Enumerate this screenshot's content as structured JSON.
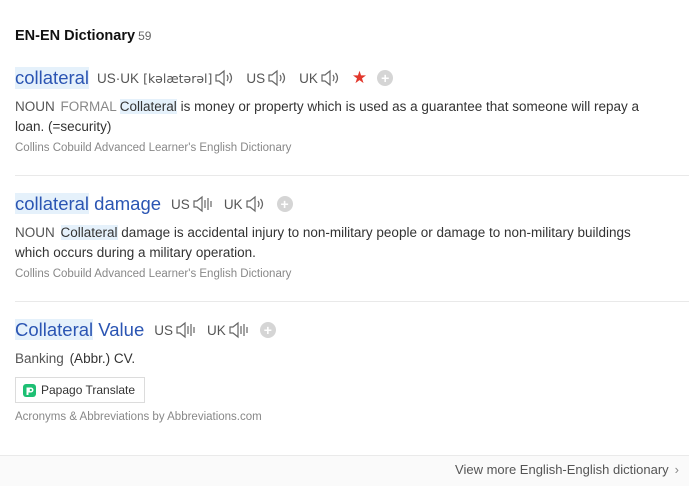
{
  "section": {
    "title": "EN-EN Dictionary",
    "count": "59"
  },
  "entries": [
    {
      "word": "collateral",
      "us_uk_label": "US·UK",
      "phonetic": "[kəlætərəl]",
      "us_label": "US",
      "uk_label": "UK",
      "pos": "NOUN",
      "register": "FORMAL",
      "def_highlight": "Collateral",
      "def_rest": " is money or property which is used as a guarantee that someone will repay a loan. (=security)",
      "source": "Collins Cobuild Advanced Learner's English Dictionary"
    },
    {
      "word_a": "collateral",
      "word_b": " damage",
      "us_label": "US",
      "uk_label": "UK",
      "pos": "NOUN",
      "def_highlight": "Collateral",
      "def_rest": " damage is accidental injury to non-military people or damage to non-military buildings which occurs during a military operation.",
      "source": "Collins Cobuild Advanced Learner's English Dictionary"
    },
    {
      "word_a": "Collateral",
      "word_b": " Value",
      "us_label": "US",
      "uk_label": "UK",
      "pos": "Banking",
      "def_rest": "(Abbr.) CV.",
      "translate_label": "Papago Translate",
      "source": "Acronyms & Abbreviations by Abbreviations.com"
    }
  ],
  "footer": {
    "more_label": "View more English-English dictionary"
  },
  "icons": {
    "speaker": "speaker-icon",
    "star": "star-icon",
    "add": "plus-icon",
    "papago": "papago-logo-icon",
    "chevron": "chevron-right-icon"
  },
  "colors": {
    "headword": "#2b55b3",
    "star": "#e2372c",
    "highlight": "#e5f1fb"
  }
}
